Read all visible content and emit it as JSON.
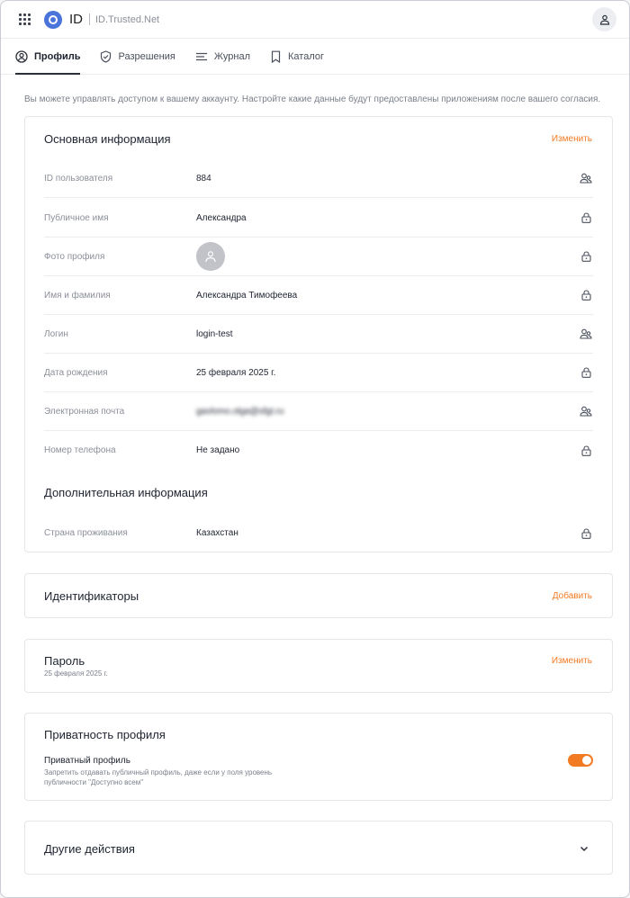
{
  "header": {
    "brand": "ID",
    "site": "ID.Trusted.Net"
  },
  "tabs": [
    {
      "label": "Профиль",
      "icon": "profile-icon"
    },
    {
      "label": "Разрешения",
      "icon": "shield-icon"
    },
    {
      "label": "Журнал",
      "icon": "list-icon"
    },
    {
      "label": "Каталог",
      "icon": "bookmark-icon"
    }
  ],
  "intro": "Вы можете управлять доступом к вашему аккаунту. Настройте какие данные будут предоставлены приложениям после вашего согласия.",
  "basic": {
    "title": "Основная информация",
    "action": "Изменить",
    "rows": [
      {
        "label": "ID пользователя",
        "value": "884",
        "icon": "users-icon"
      },
      {
        "label": "Публичное имя",
        "value": "Александра",
        "icon": "lock-icon"
      },
      {
        "label": "Фото профиля",
        "value": "",
        "icon": "lock-icon"
      },
      {
        "label": "Имя и фамилия",
        "value": "Александра Тимофеева",
        "icon": "lock-icon"
      },
      {
        "label": "Логин",
        "value": "login-test",
        "icon": "users-icon"
      },
      {
        "label": "Дата рождения",
        "value": "25 февраля 2025 г.",
        "icon": "lock-icon"
      },
      {
        "label": "Электронная почта",
        "value": "gavlomo.olga@sfgt.ru",
        "icon": "users-icon"
      },
      {
        "label": "Номер телефона",
        "value": "Не задано",
        "icon": "lock-icon"
      }
    ],
    "extra_title": "Дополнительная информация",
    "extra_rows": [
      {
        "label": "Страна проживания",
        "value": "Казахстан",
        "icon": "lock-icon"
      }
    ]
  },
  "identifiers": {
    "title": "Идентификаторы",
    "action": "Добавить"
  },
  "password": {
    "title": "Пароль",
    "date": "25 февраля 2025 г.",
    "action": "Изменить"
  },
  "privacy": {
    "title": "Приватность профиля",
    "toggle_label": "Приватный профиль",
    "toggle_desc_1": "Запретить отдавать публичный профиль, даже если у поля уровень",
    "toggle_desc_2": "публичности \"Доступно всем\"",
    "toggle_on": true
  },
  "other": {
    "title": "Другие действия"
  },
  "colors": {
    "accent": "#f27a22",
    "text": "#1e2330",
    "muted": "#8b8f99"
  }
}
